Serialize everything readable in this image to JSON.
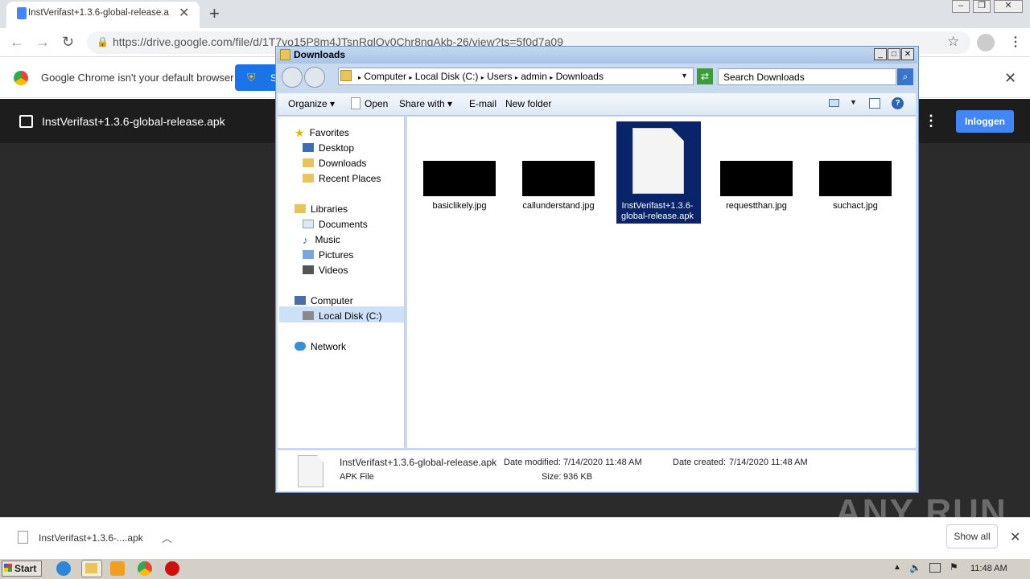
{
  "browser": {
    "tab_title": "InstVerifast+1.3.6-global-release.ap",
    "url": "https://drive.google.com/file/d/1T7yo15P8m4JTsnRqlQv0Chr8ngAkb-26/view?ts=5f0d7a09",
    "infobar_text": "Google Chrome isn't your default browser",
    "setdef_label": "S"
  },
  "drive": {
    "file_title": "InstVerifast+1.3.6-global-release.apk",
    "login_label": "Inloggen"
  },
  "explorer": {
    "window_title": "Downloads",
    "breadcrumb": [
      "Computer",
      "Local Disk (C:)",
      "Users",
      "admin",
      "Downloads"
    ],
    "search_placeholder": "Search Downloads",
    "commands": {
      "organize": "Organize",
      "open": "Open",
      "share": "Share with",
      "email": "E-mail",
      "newfolder": "New folder"
    },
    "nav": {
      "favorites": "Favorites",
      "desktop": "Desktop",
      "downloads": "Downloads",
      "recent": "Recent Places",
      "libraries": "Libraries",
      "documents": "Documents",
      "music": "Music",
      "pictures": "Pictures",
      "videos": "Videos",
      "computer": "Computer",
      "localdisk": "Local Disk (C:)",
      "network": "Network"
    },
    "files": [
      {
        "name": "basiclikely.jpg"
      },
      {
        "name": "callunderstand.jpg"
      },
      {
        "name": "InstVerifast+1.3.6-global-release.apk"
      },
      {
        "name": "requestthan.jpg"
      },
      {
        "name": "suchact.jpg"
      }
    ],
    "details": {
      "name": "InstVerifast+1.3.6-global-release.apk",
      "type": "APK File",
      "modified_label": "Date modified:",
      "modified": "7/14/2020 11:48 AM",
      "created_label": "Date created:",
      "created": "7/14/2020 11:48 AM",
      "size_label": "Size:",
      "size": "936 KB"
    }
  },
  "downloads_bar": {
    "item": "InstVerifast+1.3.6-....apk",
    "show_all": "Show all"
  },
  "taskbar": {
    "start": "Start",
    "clock": "11:48 AM"
  },
  "watermark": "ANY RUN"
}
